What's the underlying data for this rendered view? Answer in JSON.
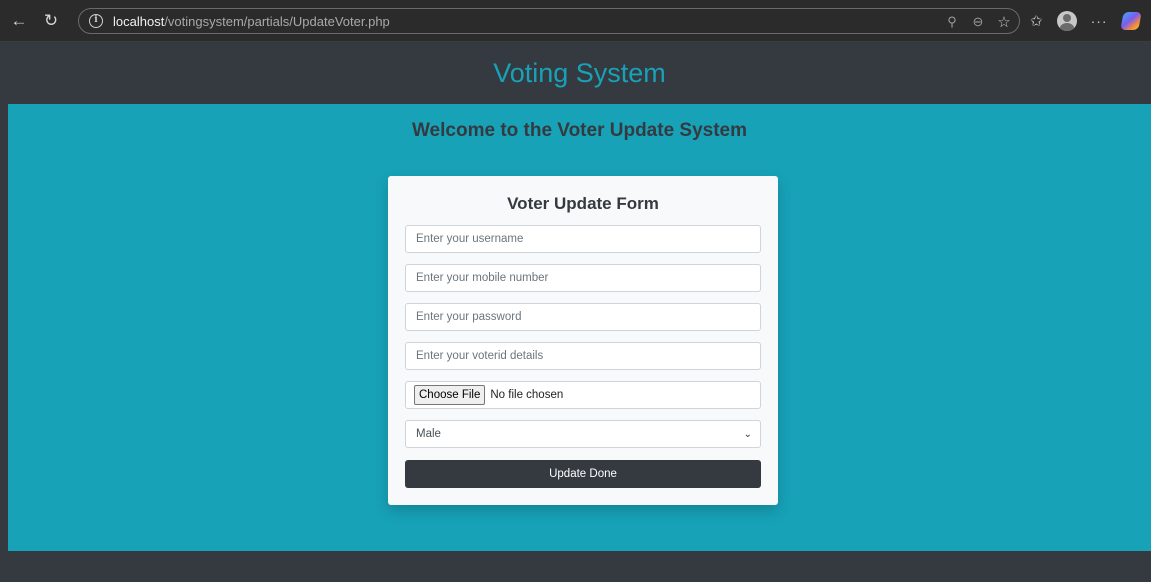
{
  "browser": {
    "url_host": "localhost",
    "url_path": "/votingsystem/partials/UpdateVoter.php",
    "back_icon": "←",
    "reload_icon": "↻",
    "info_icon": "i",
    "read_aloud_icon": "⚲",
    "zoom_icon": "⊖",
    "star_icon": "☆",
    "favorites_icon": "✩",
    "more_icon": "···"
  },
  "header": {
    "title": "Voting System"
  },
  "main": {
    "welcome": "Welcome to the Voter Update System"
  },
  "form": {
    "title": "Voter Update Form",
    "username_placeholder": "Enter your username",
    "mobile_placeholder": "Enter your mobile number",
    "password_placeholder": "Enter your password",
    "voterid_placeholder": "Enter your voterid details",
    "file_button": "Choose File",
    "file_status": "No file chosen",
    "gender_selected": "Male",
    "submit_label": "Update Done"
  },
  "colors": {
    "accent": "#17a2b8",
    "dark": "#343a40",
    "card": "#f8f9fa"
  }
}
